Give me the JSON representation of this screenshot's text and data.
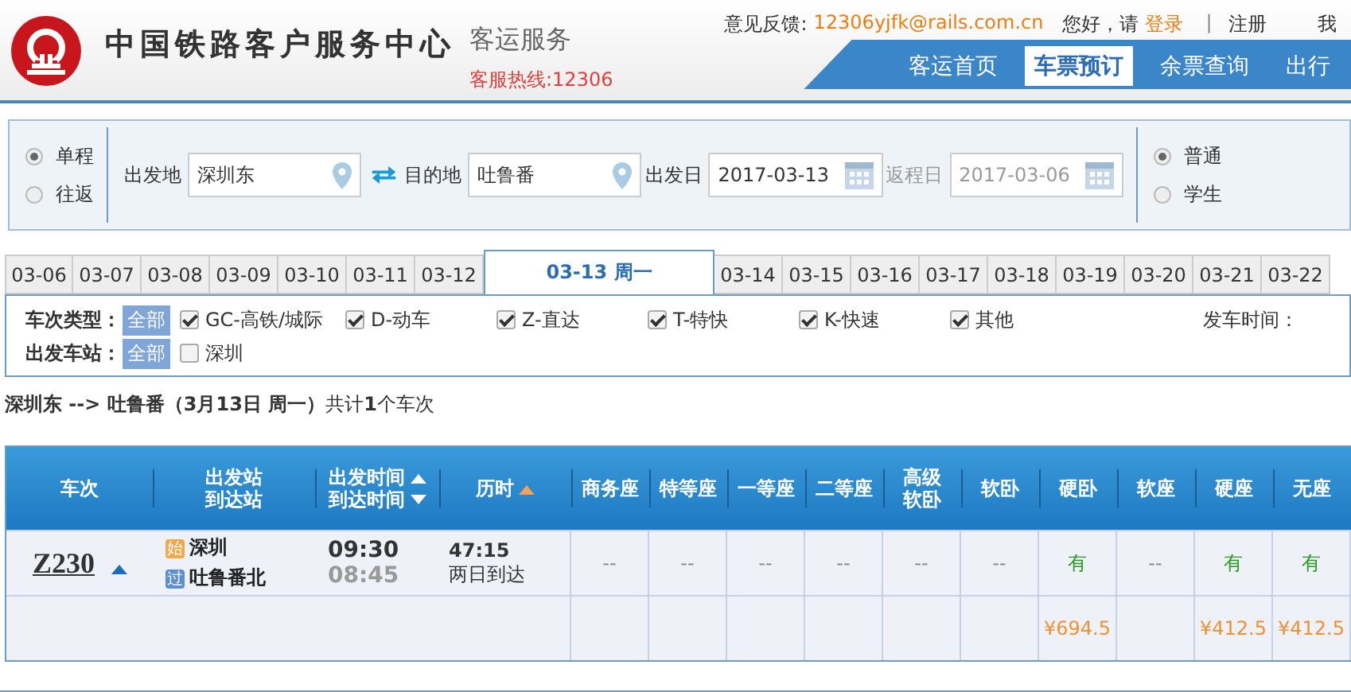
{
  "header": {
    "title": "中国铁路客户服务中心",
    "subtitle": "客运服务",
    "hotline": "客服热线:12306",
    "feedback_label": "意见反馈:",
    "feedback_email": "12306yjfk@rails.com.cn",
    "greeting": "您好，请",
    "login": "登录",
    "separator": "|",
    "register": "注册",
    "my_account": "我",
    "nav": [
      {
        "label": "客运首页",
        "selected": false
      },
      {
        "label": "车票预订",
        "selected": true
      },
      {
        "label": "余票查询",
        "selected": false
      },
      {
        "label": "出行",
        "selected": false
      }
    ]
  },
  "search": {
    "trip_types": [
      {
        "label": "单程",
        "selected": true
      },
      {
        "label": "往返",
        "selected": false
      }
    ],
    "from": {
      "label": "出发地",
      "value": "深圳东"
    },
    "to": {
      "label": "目的地",
      "value": "吐鲁番"
    },
    "depart": {
      "label": "出发日",
      "value": "2017-03-13",
      "disabled": false
    },
    "return": {
      "label": "返程日",
      "value": "2017-03-06",
      "disabled": true
    },
    "passenger_types": [
      {
        "label": "普通",
        "selected": true
      },
      {
        "label": "学生",
        "selected": false
      }
    ]
  },
  "dates": [
    {
      "label": "03-06",
      "selected": false
    },
    {
      "label": "03-07",
      "selected": false
    },
    {
      "label": "03-08",
      "selected": false
    },
    {
      "label": "03-09",
      "selected": false
    },
    {
      "label": "03-10",
      "selected": false
    },
    {
      "label": "03-11",
      "selected": false
    },
    {
      "label": "03-12",
      "selected": false
    },
    {
      "label": "03-13 周一",
      "selected": true
    },
    {
      "label": "03-14",
      "selected": false
    },
    {
      "label": "03-15",
      "selected": false
    },
    {
      "label": "03-16",
      "selected": false
    },
    {
      "label": "03-17",
      "selected": false
    },
    {
      "label": "03-18",
      "selected": false
    },
    {
      "label": "03-19",
      "selected": false
    },
    {
      "label": "03-20",
      "selected": false
    },
    {
      "label": "03-21",
      "selected": false
    },
    {
      "label": "03-22",
      "selected": false
    }
  ],
  "filters": {
    "train_type": {
      "label": "车次类型：",
      "all": "全部",
      "options": [
        {
          "label": "GC-高铁/城际",
          "checked": true
        },
        {
          "label": "D-动车",
          "checked": true
        },
        {
          "label": "Z-直达",
          "checked": true
        },
        {
          "label": "T-特快",
          "checked": true
        },
        {
          "label": "K-快速",
          "checked": true
        },
        {
          "label": "其他",
          "checked": true
        }
      ]
    },
    "station": {
      "label": "出发车站：",
      "all": "全部",
      "options": [
        {
          "label": "深圳",
          "checked": false
        }
      ]
    },
    "depart_time_label": "发车时间："
  },
  "summary": "**深圳东 --> 吐鲁番（3月13日  周一）**共计**1**个车次",
  "table": {
    "columns": [
      {
        "lines": [
          "车次"
        ]
      },
      {
        "lines": [
          "出发站",
          "到达站"
        ]
      },
      {
        "lines": [
          "出发时间",
          "到达时间"
        ],
        "sort_up": true,
        "sort_down": true
      },
      {
        "lines": [
          "历时"
        ],
        "sort_up": true
      },
      {
        "lines": [
          "商务座"
        ]
      },
      {
        "lines": [
          "特等座"
        ]
      },
      {
        "lines": [
          "一等座"
        ]
      },
      {
        "lines": [
          "二等座"
        ]
      },
      {
        "lines": [
          "高级",
          "软卧"
        ]
      },
      {
        "lines": [
          "软卧"
        ]
      },
      {
        "lines": [
          "硬卧"
        ]
      },
      {
        "lines": [
          "软座"
        ]
      },
      {
        "lines": [
          "硬座"
        ]
      },
      {
        "lines": [
          "无座"
        ]
      }
    ],
    "rows": [
      {
        "train": "Z230",
        "expanded": true,
        "from_badge": "始",
        "from": "深圳",
        "to_badge": "过",
        "to": "吐鲁番北",
        "depart": "09:30",
        "arrive": "08:45",
        "duration": "47:15",
        "arrival_day": "两日到达",
        "seats": [
          {
            "text": "--",
            "available": false
          },
          {
            "text": "--",
            "available": false
          },
          {
            "text": "--",
            "available": false
          },
          {
            "text": "--",
            "available": false
          },
          {
            "text": "--",
            "available": false
          },
          {
            "text": "--",
            "available": false
          },
          {
            "text": "有",
            "available": true,
            "price": "¥694.5"
          },
          {
            "text": "--",
            "available": false
          },
          {
            "text": "有",
            "available": true,
            "price": "¥412.5"
          },
          {
            "text": "有",
            "available": true,
            "price": "¥412.5"
          }
        ]
      }
    ]
  }
}
